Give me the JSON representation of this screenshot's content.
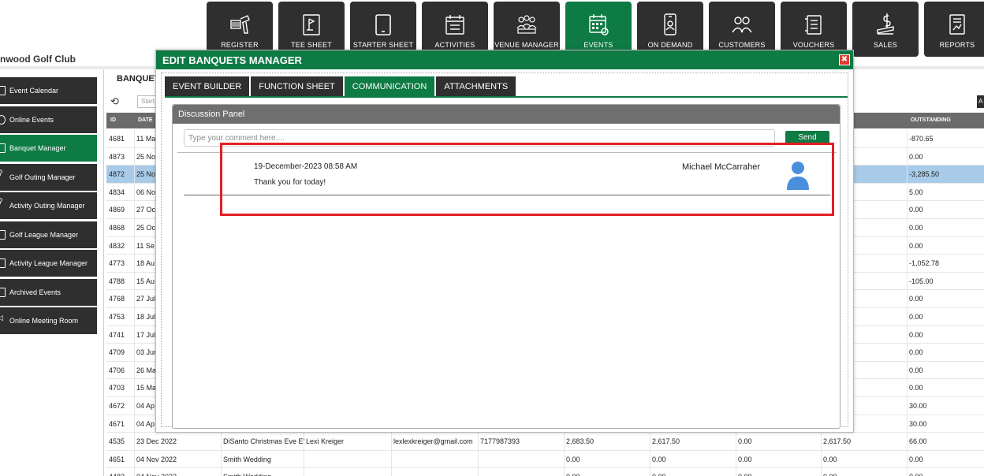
{
  "nav": {
    "tiles": [
      {
        "label": "REGISTER",
        "icon": "barcode-scanner-icon"
      },
      {
        "label": "TEE SHEET",
        "icon": "golf-flag-sheet-icon"
      },
      {
        "label": "STARTER SHEET",
        "icon": "tablet-icon"
      },
      {
        "label": "ACTIVITIES",
        "icon": "calendar-list-icon"
      },
      {
        "label": "VENUE MANAGER",
        "icon": "people-group-icon"
      },
      {
        "label": "EVENTS",
        "icon": "event-calendar-icon"
      },
      {
        "label": "ON DEMAND",
        "icon": "mobile-phone-icon"
      },
      {
        "label": "CUSTOMERS",
        "icon": "customers-icon"
      },
      {
        "label": "VOUCHERS",
        "icon": "voucher-icon"
      },
      {
        "label": "SALES",
        "icon": "sales-money-icon"
      },
      {
        "label": "REPORTS",
        "icon": "reports-icon"
      }
    ],
    "active_index": 5
  },
  "club": {
    "name": "nwood Golf Club"
  },
  "sidebar": {
    "items": [
      {
        "label": "Event Calendar"
      },
      {
        "label": "Online Events"
      },
      {
        "label": "Banquet Manager"
      },
      {
        "label": "Golf Outing Manager"
      },
      {
        "label": "Activity Outing Manager"
      },
      {
        "label": "Golf League Manager"
      },
      {
        "label": "Activity League Manager"
      },
      {
        "label": "Archived Events"
      },
      {
        "label": "Online Meeting Room"
      }
    ],
    "active_index": 2
  },
  "background": {
    "title": "BANQUET",
    "start_placeholder": "Start",
    "right_button": "A",
    "headers": {
      "id": "ID",
      "date": "DATE",
      "outstanding": "OUTSTANDING"
    },
    "rows": [
      {
        "id": "4681",
        "date": "11 Ma",
        "name": "",
        "contact": "",
        "email": "",
        "phone": "",
        "v1": "",
        "v2": "",
        "v3": "",
        "v4": "",
        "outstanding": "-870.65"
      },
      {
        "id": "4873",
        "date": "25 No",
        "name": "",
        "contact": "",
        "email": "",
        "phone": "",
        "v1": "",
        "v2": "",
        "v3": "",
        "v4": "",
        "outstanding": "0.00"
      },
      {
        "id": "4872",
        "date": "25 No",
        "name": "",
        "contact": "",
        "email": "",
        "phone": "",
        "v1": "",
        "v2": "",
        "v3": "",
        "v4": "",
        "outstanding": "-3,285.50"
      },
      {
        "id": "4834",
        "date": "06 No",
        "name": "",
        "contact": "",
        "email": "",
        "phone": "",
        "v1": "",
        "v2": "",
        "v3": "",
        "v4": "",
        "outstanding": "5.00"
      },
      {
        "id": "4869",
        "date": "27 Oc",
        "name": "",
        "contact": "",
        "email": "",
        "phone": "",
        "v1": "",
        "v2": "",
        "v3": "",
        "v4": "",
        "outstanding": "0.00"
      },
      {
        "id": "4868",
        "date": "25 Oc",
        "name": "",
        "contact": "",
        "email": "",
        "phone": "",
        "v1": "",
        "v2": "",
        "v3": "",
        "v4": "",
        "outstanding": "0.00"
      },
      {
        "id": "4832",
        "date": "11 Se",
        "name": "",
        "contact": "",
        "email": "",
        "phone": "",
        "v1": "",
        "v2": "",
        "v3": "",
        "v4": "",
        "outstanding": "0.00"
      },
      {
        "id": "4773",
        "date": "18 Au",
        "name": "",
        "contact": "",
        "email": "",
        "phone": "",
        "v1": "",
        "v2": "",
        "v3": "",
        "v4": "",
        "outstanding": "-1,052.78"
      },
      {
        "id": "4788",
        "date": "15 Au",
        "name": "",
        "contact": "",
        "email": "",
        "phone": "",
        "v1": "",
        "v2": "",
        "v3": "",
        "v4": "",
        "outstanding": "-105.00"
      },
      {
        "id": "4768",
        "date": "27 Jul",
        "name": "",
        "contact": "",
        "email": "",
        "phone": "",
        "v1": "",
        "v2": "",
        "v3": "",
        "v4": "",
        "outstanding": "0.00"
      },
      {
        "id": "4753",
        "date": "18 Jul",
        "name": "",
        "contact": "",
        "email": "",
        "phone": "",
        "v1": "",
        "v2": "",
        "v3": "",
        "v4": "",
        "outstanding": "0.00"
      },
      {
        "id": "4741",
        "date": "17 Jul",
        "name": "",
        "contact": "",
        "email": "",
        "phone": "",
        "v1": "",
        "v2": "",
        "v3": "",
        "v4": "",
        "outstanding": "0.00"
      },
      {
        "id": "4709",
        "date": "03 Jun",
        "name": "",
        "contact": "",
        "email": "",
        "phone": "",
        "v1": "",
        "v2": "",
        "v3": "",
        "v4": "",
        "outstanding": "0.00"
      },
      {
        "id": "4706",
        "date": "26 Ma",
        "name": "",
        "contact": "",
        "email": "",
        "phone": "",
        "v1": "",
        "v2": "",
        "v3": "",
        "v4": "",
        "outstanding": "0.00"
      },
      {
        "id": "4703",
        "date": "15 Ma",
        "name": "",
        "contact": "",
        "email": "",
        "phone": "",
        "v1": "",
        "v2": "",
        "v3": "",
        "v4": "",
        "outstanding": "0.00"
      },
      {
        "id": "4672",
        "date": "04 Ap",
        "name": "",
        "contact": "",
        "email": "",
        "phone": "",
        "v1": "",
        "v2": "",
        "v3": "",
        "v4": "",
        "outstanding": "30.00"
      },
      {
        "id": "4671",
        "date": "04 Ap",
        "name": "",
        "contact": "",
        "email": "",
        "phone": "",
        "v1": "",
        "v2": "",
        "v3": "",
        "v4": "",
        "outstanding": "30.00"
      },
      {
        "id": "4535",
        "date": "23 Dec 2022",
        "name": "DiSanto Christmas Eve E’",
        "contact": "Lexi Kreiger",
        "email": "lexlexkreiger@gmail.com",
        "phone": "7177987393",
        "v1": "2,683.50",
        "v2": "2,617.50",
        "v3": "0.00",
        "v4": "2,617.50",
        "outstanding": "66.00"
      },
      {
        "id": "4651",
        "date": "04 Nov 2022",
        "name": "Smith Wedding",
        "contact": "",
        "email": "",
        "phone": "",
        "v1": "0.00",
        "v2": "0.00",
        "v3": "0.00",
        "v4": "0.00",
        "outstanding": "0.00"
      },
      {
        "id": "4483",
        "date": "04 Nov 2022",
        "name": "Smith Wedding",
        "contact": "",
        "email": "",
        "phone": "",
        "v1": "0.00",
        "v2": "0.00",
        "v3": "0.00",
        "v4": "0.00",
        "outstanding": "0.00"
      }
    ],
    "selected_index": 2
  },
  "modal": {
    "title": "EDIT BANQUETS MANAGER",
    "close": "✖",
    "tabs": [
      "EVENT BUILDER",
      "FUNCTION SHEET",
      "COMMUNICATION",
      "ATTACHMENTS"
    ],
    "active_tab": 2,
    "panel": {
      "title": "Discussion Panel",
      "input_value": "",
      "input_placeholder": "Type your comment here....",
      "send_label": "Send",
      "messages": [
        {
          "timestamp": "19-December-2023  08:58 AM",
          "author": "Michael McCarraher",
          "text": "Thank you for today!",
          "avatar": "user-avatar-icon"
        }
      ]
    }
  },
  "colors": {
    "accent": "#0e7a44",
    "dark": "#2f2f2f",
    "highlight": "#e31e24",
    "selected_row": "#a7cbe8",
    "avatar": "#4a8fdc"
  }
}
